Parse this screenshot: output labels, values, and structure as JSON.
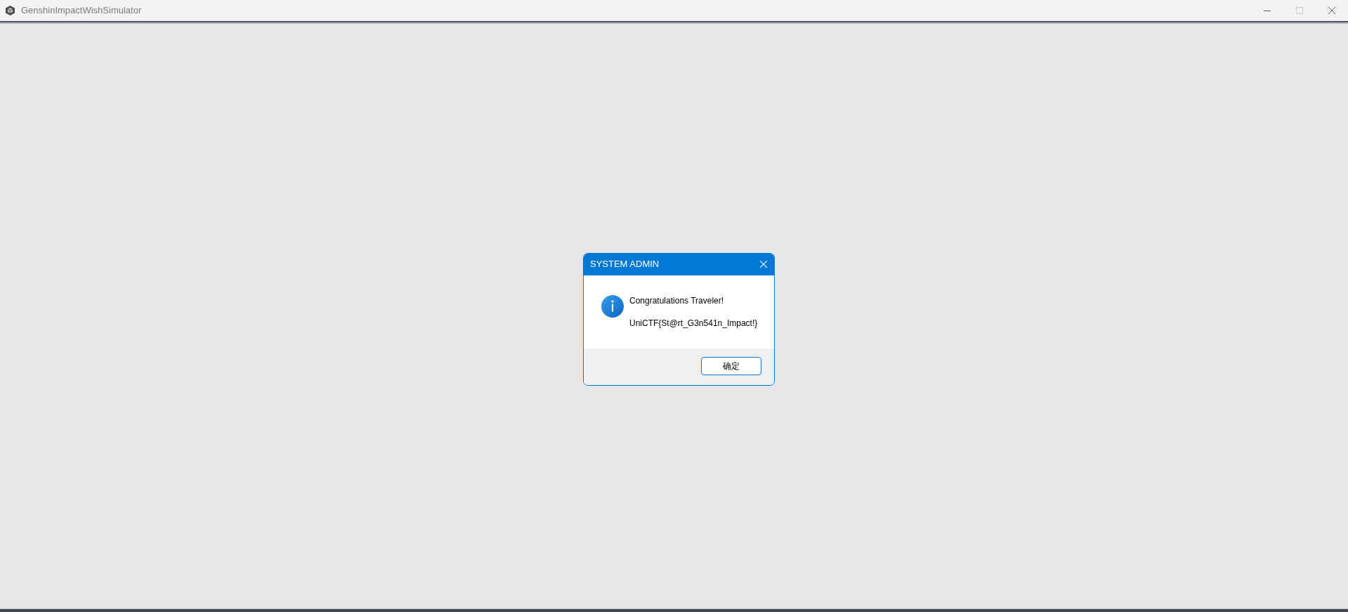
{
  "window": {
    "title": "GenshinImpactWishSimulator",
    "controls": [
      {
        "kind": "minimize",
        "disabled": false
      },
      {
        "kind": "maximize",
        "disabled": true
      },
      {
        "kind": "close",
        "disabled": false
      }
    ]
  },
  "dialog": {
    "title": "SYSTEM ADMIN",
    "lines": [
      "Congratulations Traveler!",
      "UniCTF{St@rt_G3n541n_Impact!}"
    ],
    "buttons": [
      {
        "label": "确定",
        "focused": true
      }
    ]
  }
}
